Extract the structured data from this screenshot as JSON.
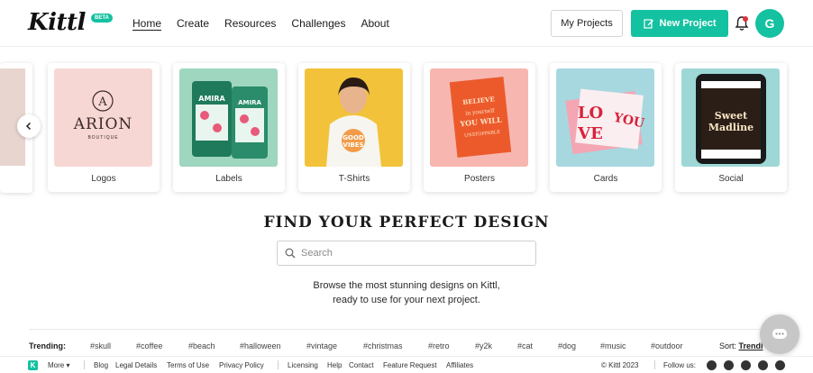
{
  "header": {
    "logo_text": "Kittl",
    "beta_badge": "BETA",
    "nav": [
      {
        "label": "Home",
        "active": true
      },
      {
        "label": "Create"
      },
      {
        "label": "Resources"
      },
      {
        "label": "Challenges"
      },
      {
        "label": "About"
      }
    ],
    "my_projects_label": "My Projects",
    "new_project_label": "New Project",
    "avatar_initial": "G",
    "colors": {
      "accent": "#14c1a0",
      "notification": "#e0323b"
    }
  },
  "carousel": {
    "categories": [
      {
        "label": "Logos",
        "thumb_text": "ARION",
        "thumb_sub": "BOUTIQUE",
        "bg": "#f7d7d4"
      },
      {
        "label": "Labels",
        "thumb_text": "AMIRA",
        "bg": "#9fd6c0"
      },
      {
        "label": "T-Shirts",
        "thumb_text": "GOOD VIBES",
        "bg": "#f2c33a"
      },
      {
        "label": "Posters",
        "thumb_text": "BELIEVE IN YOURSELF AND YOU WILL BE UNSTOPPABLE",
        "bg": "#f7b6b0"
      },
      {
        "label": "Cards",
        "thumb_text": "LOVE YOU",
        "bg": "#a7d8e0"
      },
      {
        "label": "Social",
        "thumb_text": "Sweet Madline",
        "bg": "#9dd8d6"
      }
    ]
  },
  "hero": {
    "title": "FIND YOUR PERFECT DESIGN",
    "search_placeholder": "Search",
    "browse_line1": "Browse the most stunning designs on Kittl,",
    "browse_line2": "ready to use for your next project."
  },
  "trending": {
    "title": "Trending:",
    "tags": [
      "#skull",
      "#coffee",
      "#beach",
      "#halloween",
      "#vintage",
      "#christmas",
      "#retro",
      "#y2k",
      "#cat",
      "#dog",
      "#music",
      "#outdoor"
    ],
    "sort_label": "Sort:",
    "sort_value": "Trendi"
  },
  "footer": {
    "more_label": "More",
    "links": [
      "Blog",
      "Legal Details",
      "Terms of Use",
      "Privacy Policy",
      "Licensing",
      "Help",
      "Contact",
      "Feature Request",
      "Affiliates"
    ],
    "copyright": "© Kittl 2023",
    "follow_label": "Follow us:",
    "social_icons": [
      "facebook-icon",
      "youtube-icon",
      "instagram-icon",
      "pinterest-icon",
      "twitter-icon"
    ]
  }
}
